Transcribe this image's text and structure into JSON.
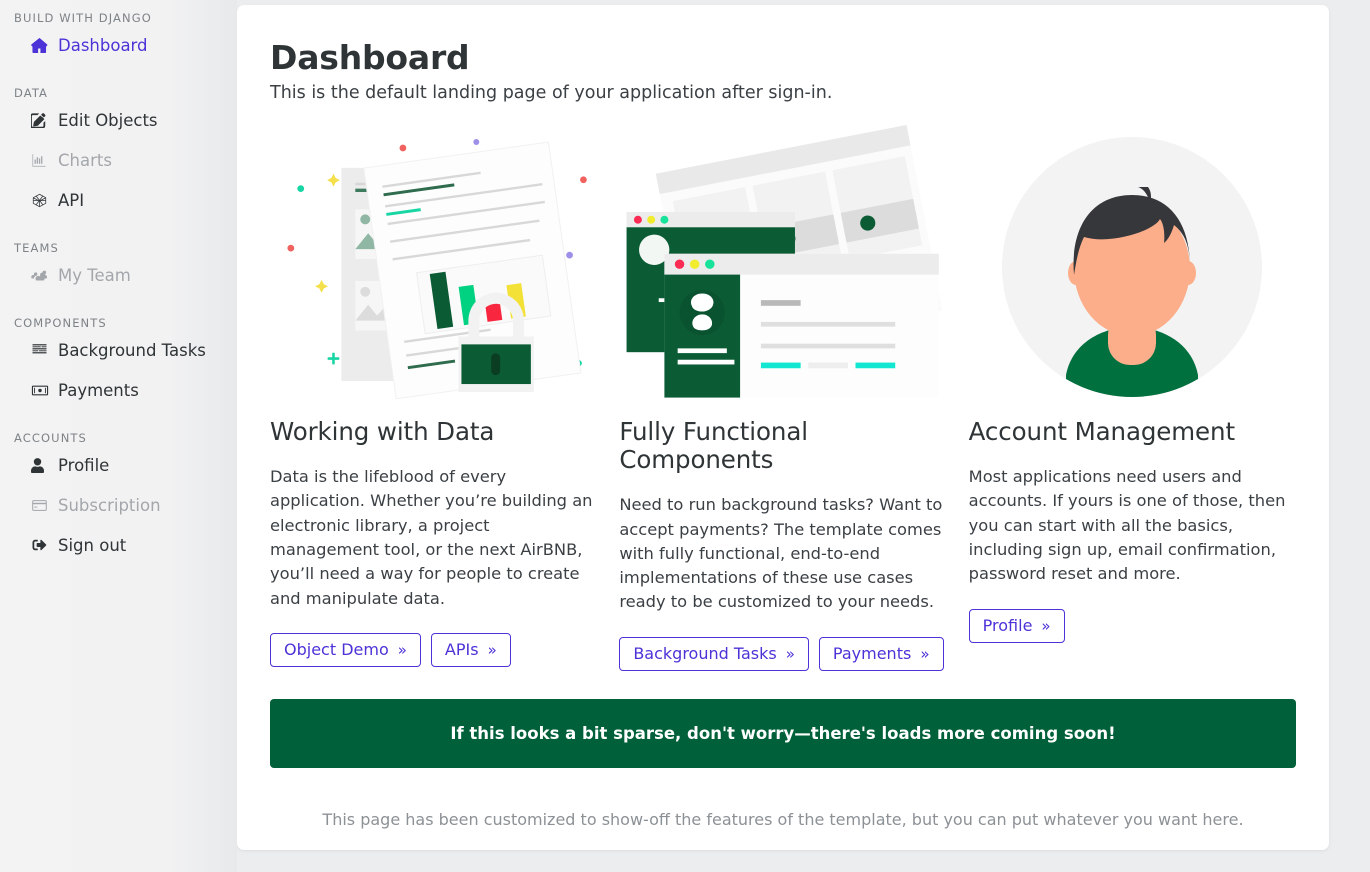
{
  "sidebar": {
    "sections": [
      {
        "heading": "BUILD WITH DJANGO",
        "items": [
          {
            "label": "Dashboard",
            "icon": "home-icon",
            "state": "active",
            "key": "dashboard"
          }
        ]
      },
      {
        "heading": "DATA",
        "items": [
          {
            "label": "Edit Objects",
            "icon": "edit-square-icon",
            "state": "normal",
            "key": "edit-objects"
          },
          {
            "label": "Charts",
            "icon": "bar-chart-icon",
            "state": "muted",
            "key": "charts"
          },
          {
            "label": "API",
            "icon": "api-hexagon-icon",
            "state": "normal",
            "key": "api"
          }
        ]
      },
      {
        "heading": "TEAMS",
        "items": [
          {
            "label": "My Team",
            "icon": "users-icon",
            "state": "muted",
            "key": "my-team"
          }
        ]
      },
      {
        "heading": "COMPONENTS",
        "items": [
          {
            "label": "Background Tasks",
            "icon": "tasks-list-icon",
            "state": "normal",
            "key": "background-tasks"
          },
          {
            "label": "Payments",
            "icon": "money-bill-icon",
            "state": "normal",
            "key": "payments"
          }
        ]
      },
      {
        "heading": "ACCOUNTS",
        "items": [
          {
            "label": "Profile",
            "icon": "user-icon",
            "state": "normal",
            "key": "profile"
          },
          {
            "label": "Subscription",
            "icon": "credit-card-icon",
            "state": "muted",
            "key": "subscription"
          },
          {
            "label": "Sign out",
            "icon": "sign-out-icon",
            "state": "normal",
            "key": "sign-out"
          }
        ]
      }
    ]
  },
  "main": {
    "title": "Dashboard",
    "subtitle": "This is the default landing page of your application after sign-in.",
    "columns": [
      {
        "illustration": "documents-chart-lock-illustration",
        "title": "Working with Data",
        "body": "Data is the lifeblood of every application. Whether you’re building an electronic library, a project management tool, or the next AirBNB, you’ll need a way for people to create and manipulate data.",
        "buttons": [
          {
            "label": "Object Demo",
            "chevron": "»"
          },
          {
            "label": "APIs",
            "chevron": "»"
          }
        ]
      },
      {
        "illustration": "browser-windows-illustration",
        "title": "Fully Functional Components",
        "body": "Need to run background tasks? Want to accept payments? The template comes with fully functional, end-to-end implementations of these use cases ready to be customized to your needs.",
        "buttons": [
          {
            "label": "Background Tasks",
            "chevron": "»"
          },
          {
            "label": "Payments",
            "chevron": "»"
          }
        ]
      },
      {
        "illustration": "user-avatar-illustration",
        "title": "Account Management",
        "body": "Most applications need users and accounts. If yours is one of those, then you can start with all the basics, including sign up, email confirmation, password reset and more.",
        "buttons": [
          {
            "label": "Profile",
            "chevron": "»"
          }
        ]
      }
    ],
    "banner": "If this looks a bit sparse, don't worry—there's loads more coming soon!",
    "footer_note": "This page has been customized to show-off the features of the template, but you can put whatever you want here."
  },
  "colors": {
    "accent": "#4b33d8",
    "brand_green": "#00603a",
    "page_bg": "#ebedef",
    "sidebar_bg": "#f2f2f3",
    "text": "#2f3437",
    "muted_text": "#a3a7ab",
    "chart_bar_dark_green": "#0b5c35",
    "chart_bar_green": "#00d282",
    "chart_bar_red": "#f8273f",
    "chart_bar_yellow": "#f4e138"
  }
}
